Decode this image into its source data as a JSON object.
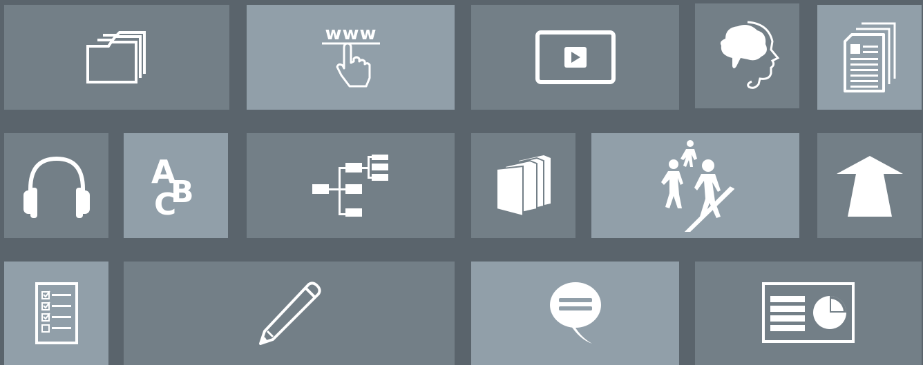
{
  "colors": {
    "background": "#5a646c",
    "tile_dark": "#737f87",
    "tile_light": "#919fa9",
    "icon": "#ffffff"
  },
  "icons": {
    "www": "www",
    "abc_a": "A",
    "abc_b": "B",
    "abc_c": "C"
  },
  "tiles": [
    {
      "id": "files",
      "icon": "folders-icon"
    },
    {
      "id": "website",
      "icon": "www-pointer-icon"
    },
    {
      "id": "video",
      "icon": "video-player-icon"
    },
    {
      "id": "mind",
      "icon": "brain-head-icon"
    },
    {
      "id": "documents",
      "icon": "documents-icon"
    },
    {
      "id": "audio",
      "icon": "headphones-icon"
    },
    {
      "id": "glossary",
      "icon": "abc-icon"
    },
    {
      "id": "mindmap",
      "icon": "mindmap-icon"
    },
    {
      "id": "library",
      "icon": "books-icon"
    },
    {
      "id": "walkthrough",
      "icon": "hiking-people-icon"
    },
    {
      "id": "upload",
      "icon": "arrow-up-icon"
    },
    {
      "id": "checklist",
      "icon": "checklist-icon"
    },
    {
      "id": "write",
      "icon": "pencil-icon"
    },
    {
      "id": "discussion",
      "icon": "speech-bubble-icon"
    },
    {
      "id": "presentation",
      "icon": "presentation-icon"
    }
  ]
}
